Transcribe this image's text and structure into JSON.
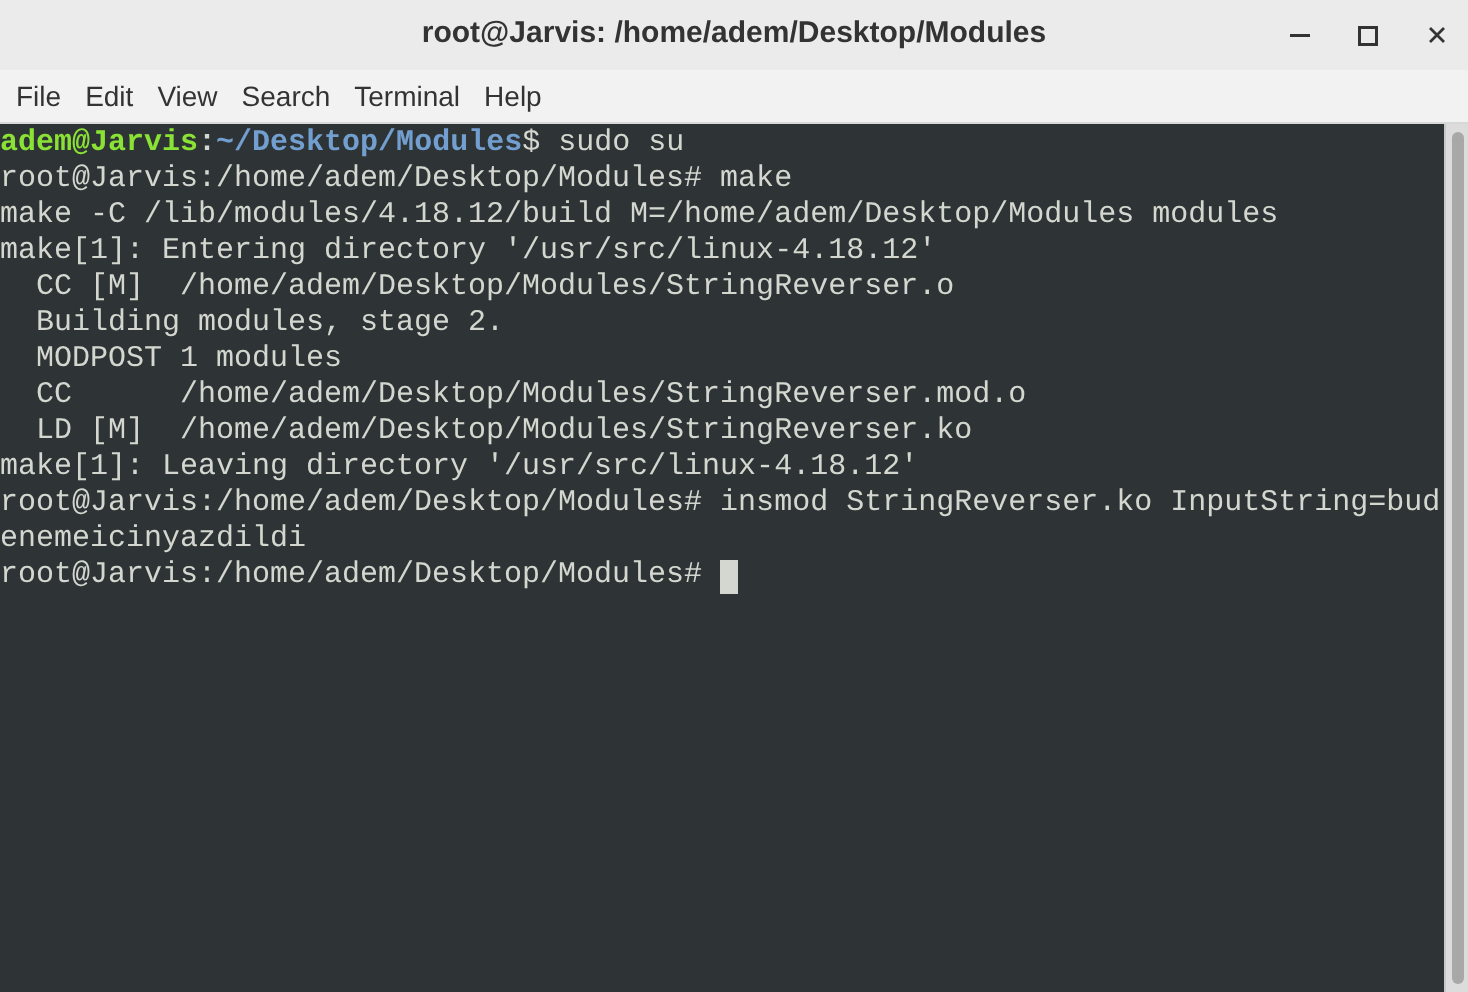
{
  "window": {
    "title": "root@Jarvis: /home/adem/Desktop/Modules"
  },
  "menu": [
    "File",
    "Edit",
    "View",
    "Search",
    "Terminal",
    "Help"
  ],
  "terminal": {
    "lines": [
      {
        "kind": "user_prompt",
        "user": "adem@Jarvis",
        "separator": ":",
        "path": "~/Desktop/Modules",
        "symbol": "$",
        "command": "sudo su"
      },
      {
        "kind": "plain",
        "text": "root@Jarvis:/home/adem/Desktop/Modules# make"
      },
      {
        "kind": "plain",
        "text": "make -C /lib/modules/4.18.12/build M=/home/adem/Desktop/Modules modules"
      },
      {
        "kind": "plain",
        "text": "make[1]: Entering directory '/usr/src/linux-4.18.12'"
      },
      {
        "kind": "plain",
        "text": "  CC [M]  /home/adem/Desktop/Modules/StringReverser.o"
      },
      {
        "kind": "plain",
        "text": "  Building modules, stage 2."
      },
      {
        "kind": "plain",
        "text": "  MODPOST 1 modules"
      },
      {
        "kind": "plain",
        "text": "  CC      /home/adem/Desktop/Modules/StringReverser.mod.o"
      },
      {
        "kind": "plain",
        "text": "  LD [M]  /home/adem/Desktop/Modules/StringReverser.ko"
      },
      {
        "kind": "plain",
        "text": "make[1]: Leaving directory '/usr/src/linux-4.18.12'"
      },
      {
        "kind": "plain",
        "text": "root@Jarvis:/home/adem/Desktop/Modules# insmod StringReverser.ko InputString=bud"
      },
      {
        "kind": "plain",
        "text": "enemeicinyazdildi"
      },
      {
        "kind": "cursor_prompt",
        "text": "root@Jarvis:/home/adem/Desktop/Modules#"
      }
    ]
  }
}
